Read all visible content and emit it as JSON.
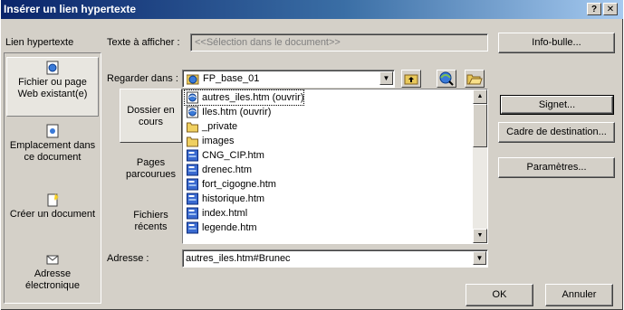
{
  "window": {
    "title": "Insérer un lien hypertexte",
    "help_label": "?",
    "close_label": "✕"
  },
  "link_to_label": "Lien hypertexte",
  "text_to_display": {
    "label": "Texte à afficher :",
    "value": "<<Sélection dans le document>>"
  },
  "info_bulle_button": "Info-bulle...",
  "look_in": {
    "label": "Regarder dans :",
    "value": "FP_base_01"
  },
  "left_panel": {
    "items": [
      {
        "label": "Fichier ou page Web existant(e)",
        "icon": "web-page-icon",
        "selected": true
      },
      {
        "label": "Emplacement dans ce document",
        "icon": "document-location-icon",
        "selected": false
      },
      {
        "label": "Créer un document",
        "icon": "new-document-icon",
        "selected": false
      },
      {
        "label": "Adresse électronique",
        "icon": "email-icon",
        "selected": false
      }
    ]
  },
  "mid_panel": {
    "items": [
      {
        "label": "Dossier en cours",
        "selected": true
      },
      {
        "label": "Pages parcourues",
        "selected": false
      },
      {
        "label": "Fichiers récents",
        "selected": false
      }
    ]
  },
  "files": [
    {
      "name": "autres_iles.htm (ouvrir)",
      "icon": "ie-page-icon",
      "selected": true
    },
    {
      "name": "Iles.htm (ouvrir)",
      "icon": "ie-page-icon",
      "selected": false
    },
    {
      "name": "_private",
      "icon": "folder-icon",
      "selected": false
    },
    {
      "name": "images",
      "icon": "folder-icon",
      "selected": false
    },
    {
      "name": "CNG_CIP.htm",
      "icon": "frontpage-page-icon",
      "selected": false
    },
    {
      "name": "drenec.htm",
      "icon": "frontpage-page-icon",
      "selected": false
    },
    {
      "name": "fort_cigogne.htm",
      "icon": "frontpage-page-icon",
      "selected": false
    },
    {
      "name": "historique.htm",
      "icon": "frontpage-page-icon",
      "selected": false
    },
    {
      "name": "index.html",
      "icon": "frontpage-page-icon",
      "selected": false
    },
    {
      "name": "legende.htm",
      "icon": "frontpage-page-icon",
      "selected": false
    }
  ],
  "right_buttons": {
    "signet": "Signet...",
    "cadre": "Cadre de destination...",
    "parametres": "Paramètres..."
  },
  "address": {
    "label": "Adresse :",
    "value": "autres_iles.htm#Brunec"
  },
  "ok_button": "OK",
  "cancel_button": "Annuler",
  "colors": {
    "title_start": "#0a246a",
    "title_end": "#a6caf0",
    "face": "#d4d0c8"
  }
}
